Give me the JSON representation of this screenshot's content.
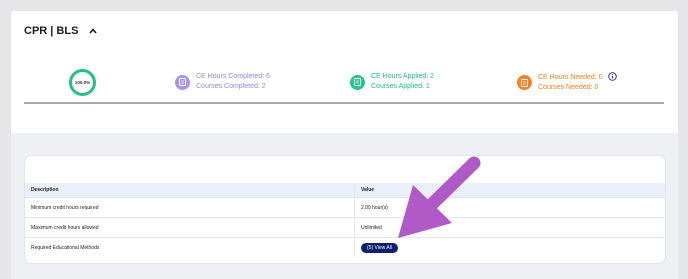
{
  "header": {
    "title": "CPR | BLS"
  },
  "progress": {
    "label": "100.0%",
    "value": 100,
    "color": "#22c087"
  },
  "stats": {
    "completed": {
      "hours": "CE Hours Completed: 6",
      "courses": "Courses Completed: 2",
      "color": "#9a84ea"
    },
    "applied": {
      "hours": "CE Hours Applied: 2",
      "courses": "Courses Applied: 1",
      "color": "#22c087"
    },
    "needed": {
      "hours": "CE Hours Needed: 0",
      "courses": "Courses Needed: 0",
      "color": "#f58025"
    }
  },
  "table": {
    "columns": [
      "Description",
      "Value"
    ],
    "rows": [
      {
        "description": "Minimum credit hours required",
        "value": "2.00 hour(s)"
      },
      {
        "description": "Maximum credit hours allowed",
        "value": "Unlimited"
      },
      {
        "description": "Required Educational Methods",
        "button": "(5) View All"
      }
    ]
  },
  "annotation": {
    "arrow_color": "#b05ac8"
  }
}
